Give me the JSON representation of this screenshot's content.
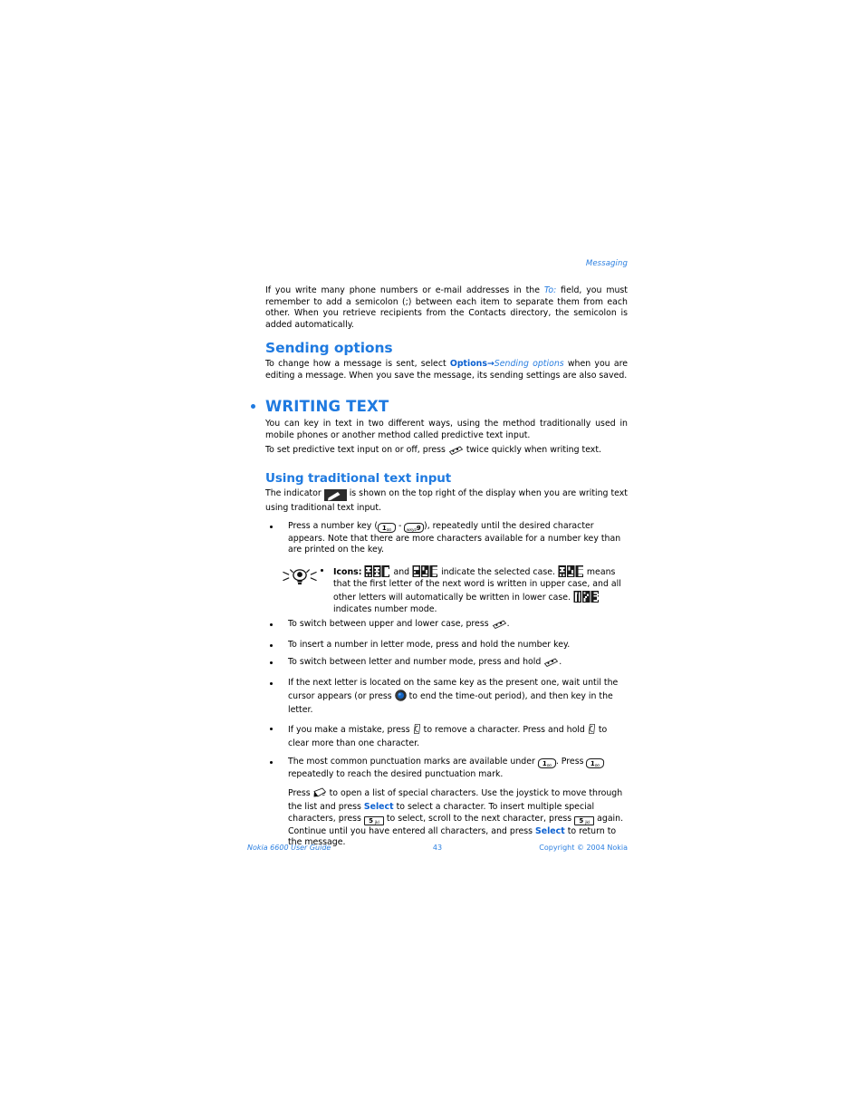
{
  "running_head": "Messaging",
  "intro_paragraph": {
    "part1": "If you write many phone numbers or e-mail addresses in the ",
    "field_label": "To:",
    "part2": " field, you must remember to add a semicolon (;) between each item to separate them from each other. When you retrieve recipients from the Contacts directory, the semicolon is added automatically."
  },
  "sending_options": {
    "heading": "Sending options",
    "text_part1": "To change how a message is sent, select ",
    "options_label": "Options",
    "arrow": "→",
    "sending_options_label": "Sending options",
    "text_part2": " when you are editing a message. When you save the message, its sending settings are also saved."
  },
  "writing_text": {
    "heading": "WRITING TEXT",
    "paragraph1": "You can key in text in two different ways, using the method traditionally used in mobile phones or another method called predictive text input.",
    "paragraph2_part1": "To set predictive text input on or off, press ",
    "paragraph2_part2": " twice quickly when writing text."
  },
  "traditional": {
    "heading": "Using traditional text input",
    "intro_part1": "The indicator ",
    "intro_part2": " is shown on the top right of the display when you are writing text using traditional text input.",
    "bullets": [
      {
        "id": "press-number-key",
        "part1": "Press a number key (",
        "key_from": {
          "digit": "1",
          "letters": "oo"
        },
        "dash": " - ",
        "key_to": {
          "digit": "9",
          "letters": "wxyz"
        },
        "part2": "), repeatedly until the desired character appears. Note that there are more characters available for a number key than are printed on the key."
      },
      {
        "id": "switch-case",
        "part1": "To switch between upper and lower case, press ",
        "part2": "."
      },
      {
        "id": "insert-number",
        "part1": "To insert a number in letter mode, press and hold the number key.",
        "part2": ""
      },
      {
        "id": "switch-letter-number",
        "part1": "To switch between letter and number mode, press and hold ",
        "part2": "."
      },
      {
        "id": "same-key-timeout",
        "part1": "If the next letter is located on the same key as the present one, wait until the cursor appears (or press ",
        "part2": " to end the time-out period), and then key in the letter."
      },
      {
        "id": "mistake-clear",
        "part1": "If you make a mistake, press ",
        "part2": " to remove a character. Press and hold ",
        "part3": " to clear more than one character."
      },
      {
        "id": "punctuation",
        "part1": "The most common punctuation marks are available under ",
        "part2": ". Press ",
        "part3": " repeatedly to reach the desired punctuation mark."
      }
    ],
    "tip": {
      "label": "Icons:",
      "text_part1": " and ",
      "text_part2": " indicate the selected case. ",
      "text_part3": " means that the first letter of the next word is written in upper case, and all other letters will automatically be written in lower case. ",
      "text_part4": " indicates number mode.",
      "badges": {
        "upper": "ABC",
        "lower": "abc",
        "mixed": "Abc",
        "number": "123"
      }
    },
    "special_chars": {
      "part1": "Press ",
      "part2": " to open a list of special characters. Use the joystick to move through the list and press ",
      "select_label_1": "Select",
      "part3": " to select a character. To insert multiple special characters, press ",
      "key": {
        "digit": "5",
        "letters": "jkl"
      },
      "part4": " to select, scroll to the next character, press ",
      "part5": " again. Continue until you have entered all characters, and press ",
      "select_label_2": "Select",
      "part6": " to return to the message."
    }
  },
  "footer": {
    "left": "Nokia 6600 User Guide",
    "page_number": "43",
    "right": "Copyright © 2004 Nokia"
  },
  "colors": {
    "link_blue": "#1f7ae0",
    "heading_blue": "#1f7ae0",
    "joystick_blue": "#1566c4"
  }
}
